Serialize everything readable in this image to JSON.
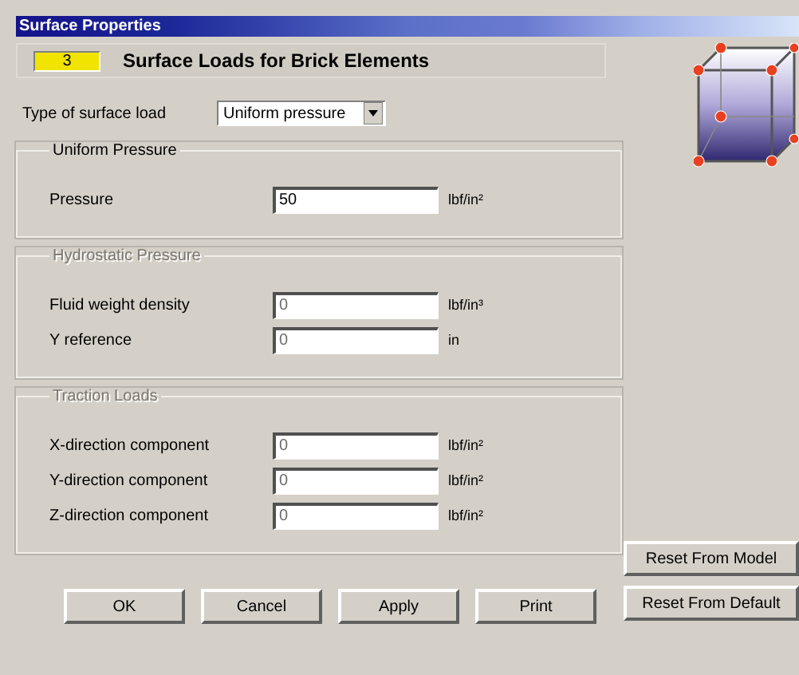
{
  "window": {
    "title": "Surface Properties"
  },
  "header": {
    "number": "3",
    "title": "Surface Loads for Brick Elements"
  },
  "load_type": {
    "label": "Type of surface load",
    "value": "Uniform pressure"
  },
  "groups": [
    {
      "legend": "Uniform Pressure",
      "disabled": false,
      "fields": [
        {
          "label": "Pressure",
          "value": "50",
          "unit": "lbf/in²"
        }
      ]
    },
    {
      "legend": "Hydrostatic Pressure",
      "disabled": true,
      "fields": [
        {
          "label": "Fluid weight density",
          "value": "0",
          "unit": "lbf/in³"
        },
        {
          "label": "Y reference",
          "value": "0",
          "unit": "in"
        }
      ]
    },
    {
      "legend": "Traction Loads",
      "disabled": true,
      "fields": [
        {
          "label": "X-direction component",
          "value": "0",
          "unit": "lbf/in²"
        },
        {
          "label": "Y-direction component",
          "value": "0",
          "unit": "lbf/in²"
        },
        {
          "label": "Z-direction component",
          "value": "0",
          "unit": "lbf/in²"
        }
      ]
    }
  ],
  "buttons": [
    "OK",
    "Cancel",
    "Apply",
    "Print"
  ],
  "reset_buttons": [
    "Reset From Model",
    "Reset From Default"
  ]
}
